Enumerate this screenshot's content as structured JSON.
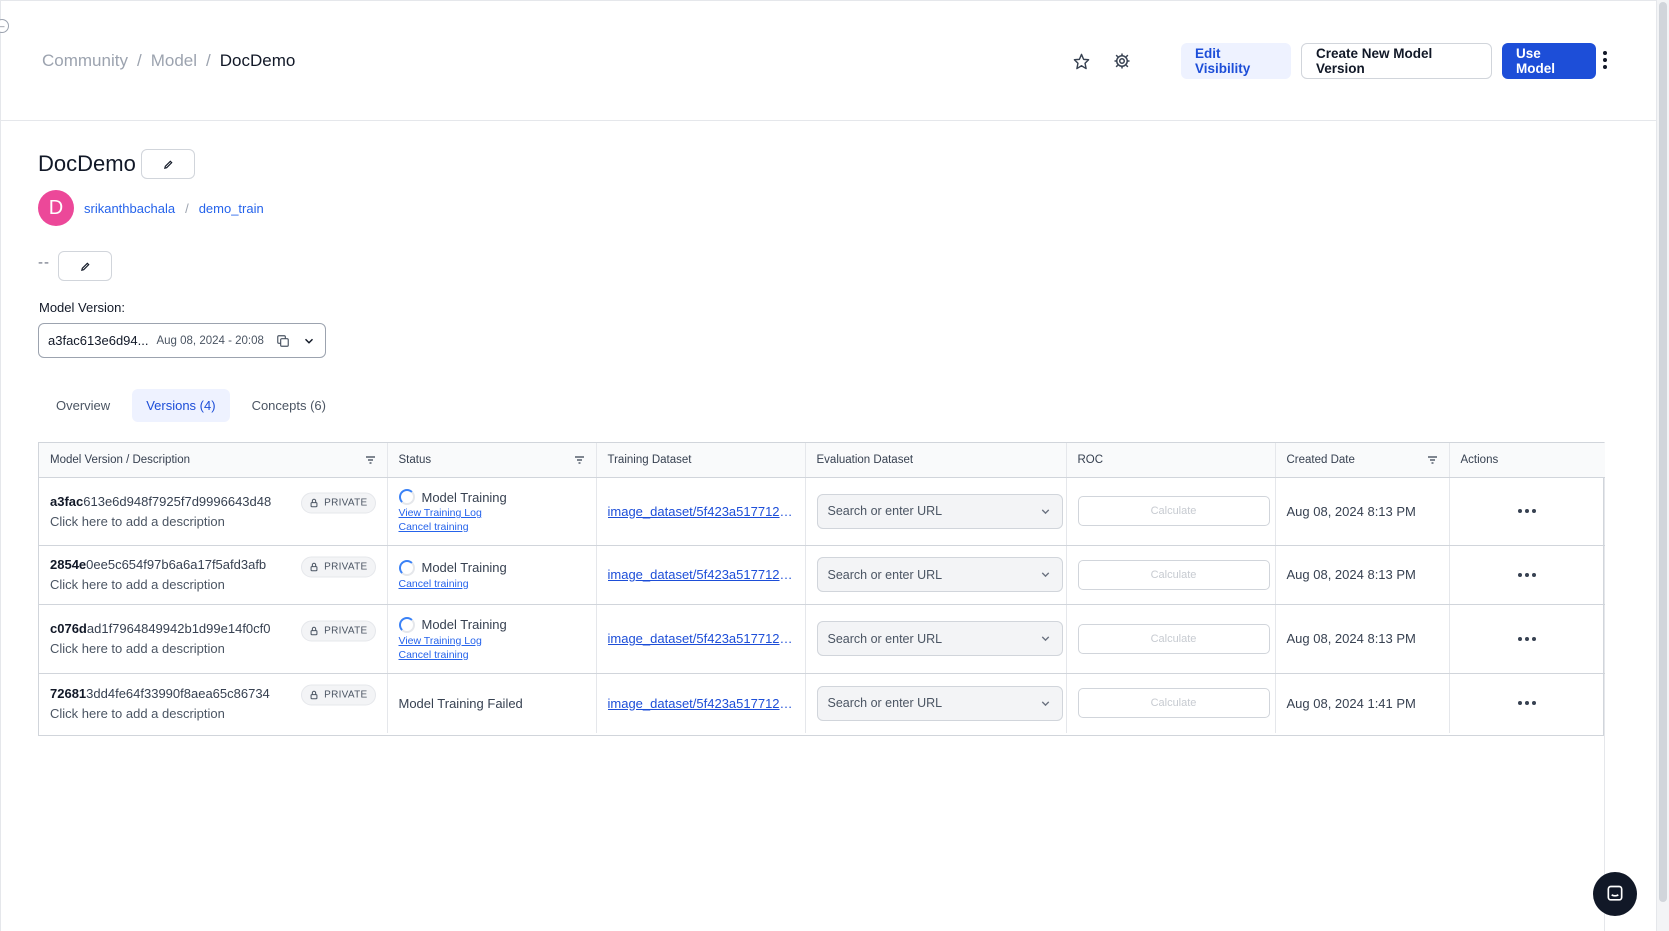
{
  "header": {
    "breadcrumb": [
      "Community",
      "Model",
      "DocDemo"
    ],
    "separator": "/",
    "edit_visibility_label": "Edit Visibility",
    "create_version_label": "Create New Model Version",
    "use_model_label": "Use Model"
  },
  "model": {
    "title": "DocDemo",
    "avatar_letter": "D",
    "owner": "srikanthbachala",
    "owner_sep": "/",
    "app": "demo_train",
    "description": "--"
  },
  "version_picker": {
    "label": "Model Version:",
    "selected_id": "a3fac613e6d94...",
    "selected_date": "Aug 08, 2024 - 20:08"
  },
  "tabs": [
    {
      "label": "Overview",
      "active": false
    },
    {
      "label": "Versions (4)",
      "active": true
    },
    {
      "label": "Concepts (6)",
      "active": false
    }
  ],
  "table": {
    "columns": [
      "Model Version / Description",
      "Status",
      "Training Dataset",
      "Evaluation Dataset",
      "ROC",
      "Created Date",
      "Actions"
    ],
    "rows": [
      {
        "id_prefix": "a3fac",
        "id_rest": "613e6d948f7925f7d9996643d48",
        "badge": "PRIVATE",
        "description": "Click here to add a description",
        "status": "Model Training",
        "links": [
          "View Training Log",
          "Cancel training"
        ],
        "training_dataset": "image_dataset/5f423a5177124...",
        "eval_placeholder": "Search or enter URL",
        "roc_button": "Calculate",
        "created": "Aug 08, 2024 8:13 PM"
      },
      {
        "id_prefix": "2854e",
        "id_rest": "0ee5c654f97b6a6a17f5afd3afb",
        "badge": "PRIVATE",
        "description": "Click here to add a description",
        "status": "Model Training",
        "links": [
          "Cancel training"
        ],
        "training_dataset": "image_dataset/5f423a5177124...",
        "eval_placeholder": "Search or enter URL",
        "roc_button": "Calculate",
        "created": "Aug 08, 2024 8:13 PM"
      },
      {
        "id_prefix": "c076d",
        "id_rest": "ad1f7964849942b1d99e14f0cf0",
        "badge": "PRIVATE",
        "description": "Click here to add a description",
        "status": "Model Training",
        "links": [
          "View Training Log",
          "Cancel training"
        ],
        "training_dataset": "image_dataset/5f423a5177124...",
        "eval_placeholder": "Search or enter URL",
        "roc_button": "Calculate",
        "created": "Aug 08, 2024 8:13 PM"
      },
      {
        "id_prefix": "72681",
        "id_rest": "3dd4fe64f33990f8aea65c86734",
        "badge": "PRIVATE",
        "description": "Click here to add a description",
        "status": "Model Training Failed",
        "links": [],
        "training_dataset": "image_dataset/5f423a5177124...",
        "eval_placeholder": "Search or enter URL",
        "roc_button": "Calculate",
        "created": "Aug 08, 2024 1:41 PM"
      }
    ]
  },
  "colors": {
    "primary": "#1d4ed8",
    "avatar": "#ec4899",
    "link": "#2563eb"
  },
  "icons": [
    "star-icon",
    "gear-icon",
    "pencil-icon",
    "copy-icon",
    "chevron-down-icon",
    "filter-icon",
    "lock-icon",
    "spinner-icon",
    "more-horizontal-icon",
    "chat-icon"
  ]
}
